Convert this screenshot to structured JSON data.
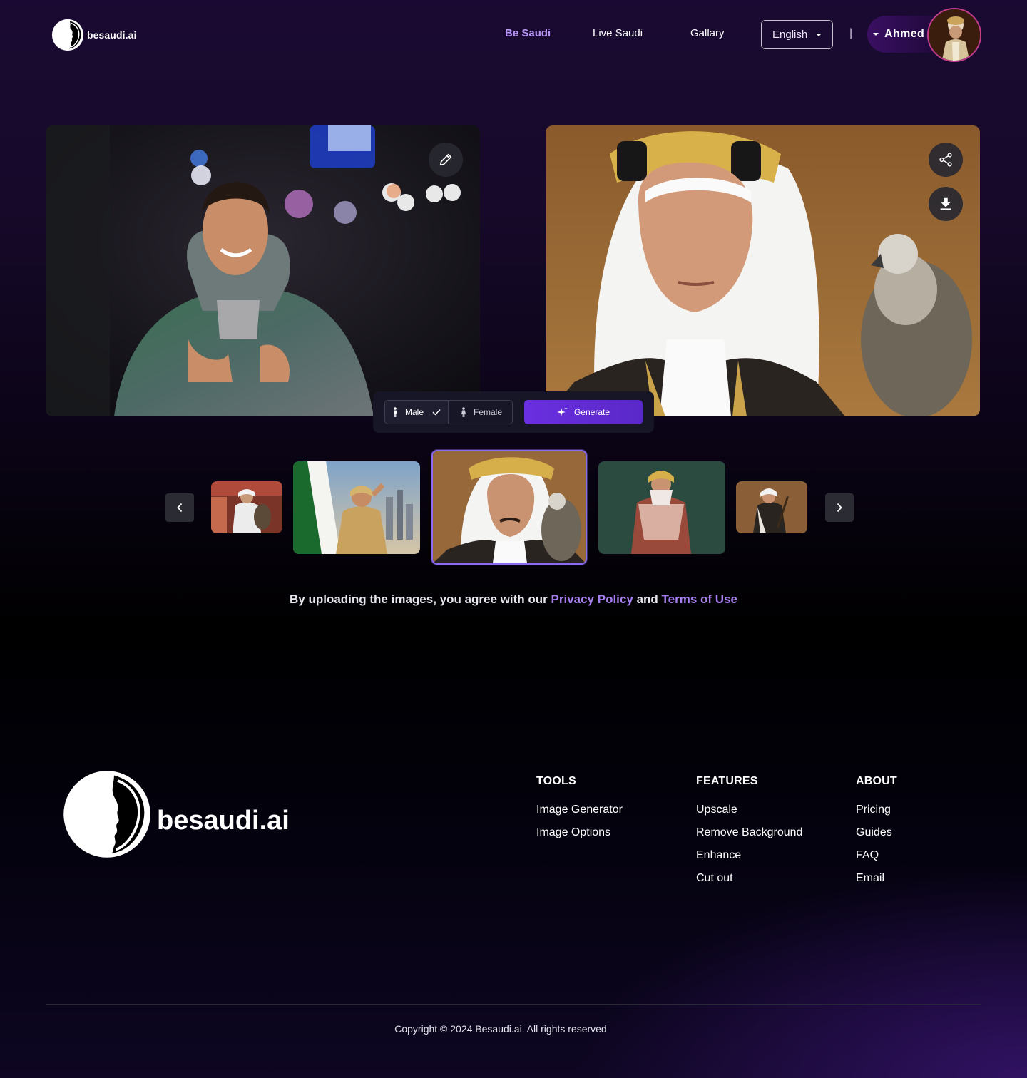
{
  "header": {
    "logo_text": "besaudi.ai",
    "nav": [
      {
        "label": "Be Saudi",
        "active": true
      },
      {
        "label": "Live Saudi",
        "active": false
      },
      {
        "label": "Gallary",
        "active": false
      }
    ],
    "language": {
      "selected": "English"
    },
    "divider": "|",
    "user_name": "Ahmed"
  },
  "editor": {
    "source_photo_icon": "pencil-icon",
    "result_photo_icons": [
      "share-icon",
      "download-icon"
    ],
    "gender_options": [
      {
        "label": "Male",
        "selected": true
      },
      {
        "label": "Female",
        "selected": false
      }
    ],
    "generate_label": "Generate"
  },
  "carousel": {
    "thumbnails": 5,
    "selected_index": 2
  },
  "consent": {
    "prefix": "By uploading the images, you agree with our",
    "privacy": "Privacy Policy",
    "and": "and",
    "terms": "Terms of Use"
  },
  "footer": {
    "logo_text": "besaudi.ai",
    "columns": [
      {
        "title": "TOOLS",
        "items": [
          "Image Generator",
          "Image Options"
        ]
      },
      {
        "title": "FEATURES",
        "items": [
          "Upscale",
          "Remove Background",
          "Enhance",
          "Cut out"
        ]
      },
      {
        "title": "ABOUT",
        "items": [
          "Pricing",
          "Guides",
          "FAQ",
          "Email"
        ]
      }
    ],
    "copyright": "Copyright © 2024 Besaudi.ai. All rights reserved"
  },
  "colors": {
    "accent": "#b795f5",
    "link": "#a57ef0",
    "generate": "#6a2fe0"
  }
}
